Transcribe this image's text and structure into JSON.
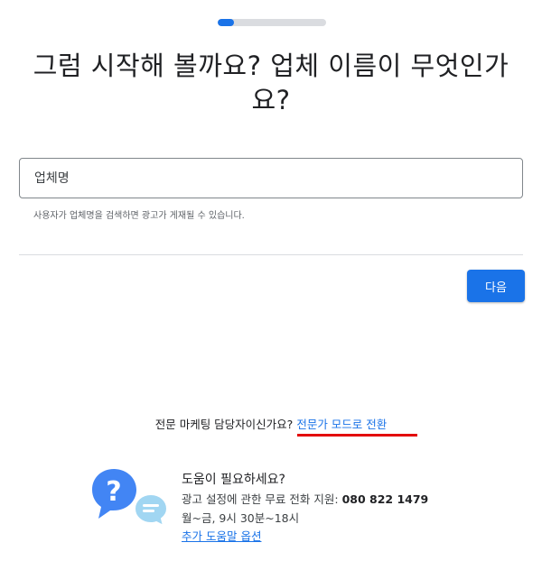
{
  "progress": {
    "fraction": 0.15,
    "color": "#1a73e8"
  },
  "headline": "그럼 시작해 볼까요? 업체 이름이 무엇인가요?",
  "business_name_field": {
    "placeholder": "업체명",
    "value": "",
    "helper": "사용자가 업체명을 검색하면 광고가 게재될 수 있습니다."
  },
  "next_button": {
    "label": "다음",
    "color": "#1a73e8"
  },
  "expert_mode": {
    "prompt": "전문 마케팅 담당자이신가요?",
    "link": "전문가 모드로 전환",
    "highlight_color": "#e30b0b"
  },
  "help": {
    "icon": "help-chat-icon",
    "title": "도움이 필요하세요?",
    "phone_label": "광고 설정에 관한 무료 전화 지원:",
    "phone_number": "080 822 1479",
    "hours": "월~금, 9시 30분~18시",
    "more_link": "추가 도움말 옵션"
  }
}
